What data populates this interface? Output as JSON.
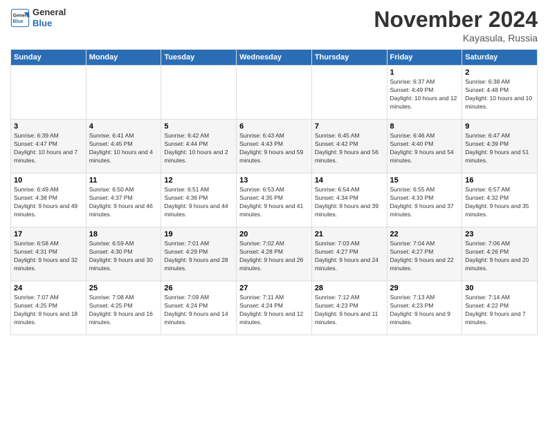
{
  "header": {
    "logo_line1": "General",
    "logo_line2": "Blue",
    "month_title": "November 2024",
    "location": "Kayasula, Russia"
  },
  "weekdays": [
    "Sunday",
    "Monday",
    "Tuesday",
    "Wednesday",
    "Thursday",
    "Friday",
    "Saturday"
  ],
  "weeks": [
    [
      {
        "day": "",
        "info": ""
      },
      {
        "day": "",
        "info": ""
      },
      {
        "day": "",
        "info": ""
      },
      {
        "day": "",
        "info": ""
      },
      {
        "day": "",
        "info": ""
      },
      {
        "day": "1",
        "info": "Sunrise: 6:37 AM\nSunset: 4:49 PM\nDaylight: 10 hours and 12 minutes."
      },
      {
        "day": "2",
        "info": "Sunrise: 6:38 AM\nSunset: 4:48 PM\nDaylight: 10 hours and 10 minutes."
      }
    ],
    [
      {
        "day": "3",
        "info": "Sunrise: 6:39 AM\nSunset: 4:47 PM\nDaylight: 10 hours and 7 minutes."
      },
      {
        "day": "4",
        "info": "Sunrise: 6:41 AM\nSunset: 4:45 PM\nDaylight: 10 hours and 4 minutes."
      },
      {
        "day": "5",
        "info": "Sunrise: 6:42 AM\nSunset: 4:44 PM\nDaylight: 10 hours and 2 minutes."
      },
      {
        "day": "6",
        "info": "Sunrise: 6:43 AM\nSunset: 4:43 PM\nDaylight: 9 hours and 59 minutes."
      },
      {
        "day": "7",
        "info": "Sunrise: 6:45 AM\nSunset: 4:42 PM\nDaylight: 9 hours and 56 minutes."
      },
      {
        "day": "8",
        "info": "Sunrise: 6:46 AM\nSunset: 4:40 PM\nDaylight: 9 hours and 54 minutes."
      },
      {
        "day": "9",
        "info": "Sunrise: 6:47 AM\nSunset: 4:39 PM\nDaylight: 9 hours and 51 minutes."
      }
    ],
    [
      {
        "day": "10",
        "info": "Sunrise: 6:49 AM\nSunset: 4:38 PM\nDaylight: 9 hours and 49 minutes."
      },
      {
        "day": "11",
        "info": "Sunrise: 6:50 AM\nSunset: 4:37 PM\nDaylight: 9 hours and 46 minutes."
      },
      {
        "day": "12",
        "info": "Sunrise: 6:51 AM\nSunset: 4:36 PM\nDaylight: 9 hours and 44 minutes."
      },
      {
        "day": "13",
        "info": "Sunrise: 6:53 AM\nSunset: 4:35 PM\nDaylight: 9 hours and 41 minutes."
      },
      {
        "day": "14",
        "info": "Sunrise: 6:54 AM\nSunset: 4:34 PM\nDaylight: 9 hours and 39 minutes."
      },
      {
        "day": "15",
        "info": "Sunrise: 6:55 AM\nSunset: 4:33 PM\nDaylight: 9 hours and 37 minutes."
      },
      {
        "day": "16",
        "info": "Sunrise: 6:57 AM\nSunset: 4:32 PM\nDaylight: 9 hours and 35 minutes."
      }
    ],
    [
      {
        "day": "17",
        "info": "Sunrise: 6:58 AM\nSunset: 4:31 PM\nDaylight: 9 hours and 32 minutes."
      },
      {
        "day": "18",
        "info": "Sunrise: 6:59 AM\nSunset: 4:30 PM\nDaylight: 9 hours and 30 minutes."
      },
      {
        "day": "19",
        "info": "Sunrise: 7:01 AM\nSunset: 4:29 PM\nDaylight: 9 hours and 28 minutes."
      },
      {
        "day": "20",
        "info": "Sunrise: 7:02 AM\nSunset: 4:28 PM\nDaylight: 9 hours and 26 minutes."
      },
      {
        "day": "21",
        "info": "Sunrise: 7:03 AM\nSunset: 4:27 PM\nDaylight: 9 hours and 24 minutes."
      },
      {
        "day": "22",
        "info": "Sunrise: 7:04 AM\nSunset: 4:27 PM\nDaylight: 9 hours and 22 minutes."
      },
      {
        "day": "23",
        "info": "Sunrise: 7:06 AM\nSunset: 4:26 PM\nDaylight: 9 hours and 20 minutes."
      }
    ],
    [
      {
        "day": "24",
        "info": "Sunrise: 7:07 AM\nSunset: 4:25 PM\nDaylight: 9 hours and 18 minutes."
      },
      {
        "day": "25",
        "info": "Sunrise: 7:08 AM\nSunset: 4:25 PM\nDaylight: 9 hours and 16 minutes."
      },
      {
        "day": "26",
        "info": "Sunrise: 7:09 AM\nSunset: 4:24 PM\nDaylight: 9 hours and 14 minutes."
      },
      {
        "day": "27",
        "info": "Sunrise: 7:11 AM\nSunset: 4:24 PM\nDaylight: 9 hours and 12 minutes."
      },
      {
        "day": "28",
        "info": "Sunrise: 7:12 AM\nSunset: 4:23 PM\nDaylight: 9 hours and 11 minutes."
      },
      {
        "day": "29",
        "info": "Sunrise: 7:13 AM\nSunset: 4:23 PM\nDaylight: 9 hours and 9 minutes."
      },
      {
        "day": "30",
        "info": "Sunrise: 7:14 AM\nSunset: 4:22 PM\nDaylight: 9 hours and 7 minutes."
      }
    ]
  ]
}
